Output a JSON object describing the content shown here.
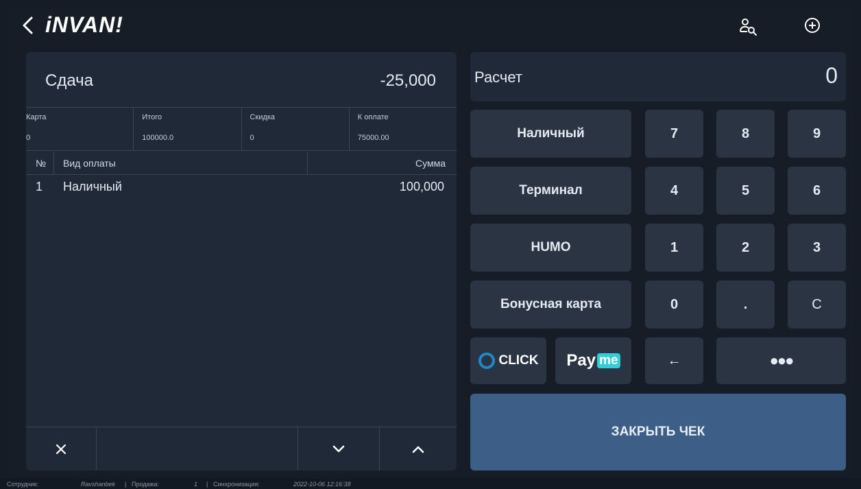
{
  "app": {
    "logo": "iNVAN!"
  },
  "header": {
    "back_icon": "chevron-left-icon",
    "search_user_icon": "user-search-icon",
    "add_icon": "plus-circle-icon"
  },
  "change": {
    "label": "Сдача",
    "value": "-25,000"
  },
  "summary": [
    {
      "label": "Карта",
      "value": "0"
    },
    {
      "label": "Итого",
      "value": "100000.0"
    },
    {
      "label": "Скидка",
      "value": "0"
    },
    {
      "label": "К оплате",
      "value": "75000.00"
    }
  ],
  "payments_table": {
    "headers": {
      "num": "№",
      "type": "Вид оплаты",
      "sum": "Сумма"
    },
    "rows": [
      {
        "num": "1",
        "type": "Наличный",
        "sum": "100,000"
      }
    ]
  },
  "tools": {
    "delete_icon": "close-icon",
    "down_icon": "chevron-down-icon",
    "up_icon": "chevron-up-icon"
  },
  "calc": {
    "label": "Расчет",
    "value": "0"
  },
  "payment_types": {
    "cash": "Наличный",
    "terminal": "Терминал",
    "humo": "HUMO",
    "bonus": "Бонусная карта",
    "click": "CLICK",
    "payme_pay": "Pay",
    "payme_me": "me"
  },
  "keypad": {
    "k7": "7",
    "k8": "8",
    "k9": "9",
    "k4": "4",
    "k5": "5",
    "k6": "6",
    "k1": "1",
    "k2": "2",
    "k3": "3",
    "k0": "0",
    "kdot": ".",
    "kc": "C",
    "backspace": "←",
    "more": "●●●"
  },
  "close_check": "ЗАКРЫТЬ ЧЕК",
  "status": {
    "employee_label": "Сотрудник:",
    "employee": "Ravshanbek",
    "sep1": "|",
    "sale_label": "Продажа:",
    "sale": "1",
    "sep2": "|",
    "sync_label": "Синхронизация:",
    "sync": "2022-10-06 12:16:38"
  },
  "colors": {
    "background": "#151c26",
    "panel": "#1f2937",
    "key": "#2a3443",
    "accent": "#3d5e86",
    "payme_accent": "#33ccd9",
    "click_accent": "#1e88c8"
  }
}
